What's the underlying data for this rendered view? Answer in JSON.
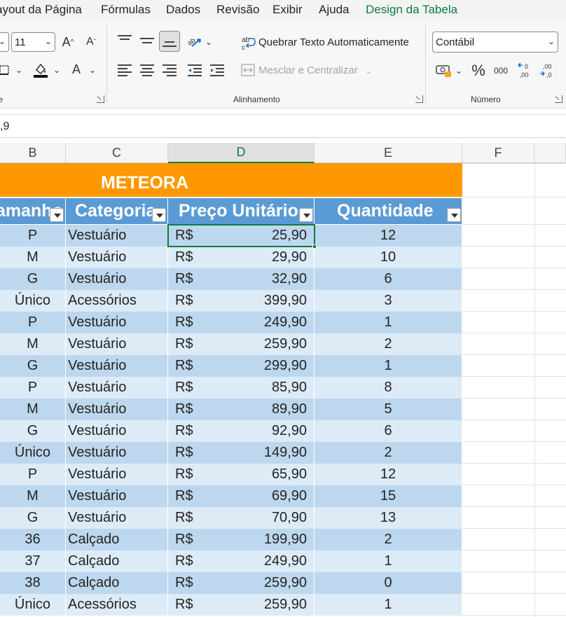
{
  "ribbon_tabs": [
    {
      "label": "ayout da Página"
    },
    {
      "label": "Fórmulas"
    },
    {
      "label": "Dados"
    },
    {
      "label": "Revisão"
    },
    {
      "label": "Exibir"
    },
    {
      "label": "Ajuda"
    },
    {
      "label": "Design da Tabela"
    }
  ],
  "font_group": {
    "size_value": "11",
    "label_fragment": "te"
  },
  "alignment_group": {
    "wrap_text_label": "Quebrar Texto Automaticamente",
    "merge_center_label": "Mesclar e Centralizar",
    "label": "Alinhamento"
  },
  "number_group": {
    "format_value": "Contábil",
    "percent_symbol": "%",
    "thousands_symbol": "000",
    "label": "Número"
  },
  "formula_bar": {
    "value": ",9"
  },
  "columns": [
    "B",
    "C",
    "D",
    "E",
    "F"
  ],
  "active_column": "D",
  "table": {
    "title": "METEORA",
    "headers": {
      "b": "amanho",
      "c": "Categoria",
      "d": "Preço Unitário",
      "e": "Quantidade"
    },
    "currency": "R$",
    "rows": [
      {
        "b": "P",
        "c": "Vestuário",
        "d": "25,90",
        "e": "12"
      },
      {
        "b": "M",
        "c": "Vestuário",
        "d": "29,90",
        "e": "10"
      },
      {
        "b": "G",
        "c": "Vestuário",
        "d": "32,90",
        "e": "6"
      },
      {
        "b": "Único",
        "c": "Acessórios",
        "d": "399,90",
        "e": "3"
      },
      {
        "b": "P",
        "c": "Vestuário",
        "d": "249,90",
        "e": "1"
      },
      {
        "b": "M",
        "c": "Vestuário",
        "d": "259,90",
        "e": "2"
      },
      {
        "b": "G",
        "c": "Vestuário",
        "d": "299,90",
        "e": "1"
      },
      {
        "b": "P",
        "c": "Vestuário",
        "d": "85,90",
        "e": "8"
      },
      {
        "b": "M",
        "c": "Vestuário",
        "d": "89,90",
        "e": "5"
      },
      {
        "b": "G",
        "c": "Vestuário",
        "d": "92,90",
        "e": "6"
      },
      {
        "b": "Único",
        "c": "Vestuário",
        "d": "149,90",
        "e": "2"
      },
      {
        "b": "P",
        "c": "Vestuário",
        "d": "65,90",
        "e": "12"
      },
      {
        "b": "M",
        "c": "Vestuário",
        "d": "69,90",
        "e": "15"
      },
      {
        "b": "G",
        "c": "Vestuário",
        "d": "70,90",
        "e": "13"
      },
      {
        "b": "36",
        "c": "Calçado",
        "d": "199,90",
        "e": "2"
      },
      {
        "b": "37",
        "c": "Calçado",
        "d": "249,90",
        "e": "1"
      },
      {
        "b": "38",
        "c": "Calçado",
        "d": "259,90",
        "e": "0"
      },
      {
        "b": "Único",
        "c": "Acessórios",
        "d": "259,90",
        "e": "1"
      }
    ]
  },
  "colors": {
    "accent_green": "#107c41",
    "title_band": "#ff9800",
    "header_blue": "#5b9bd5",
    "row_dark": "#bdd7ee",
    "row_light": "#ddebf7"
  }
}
